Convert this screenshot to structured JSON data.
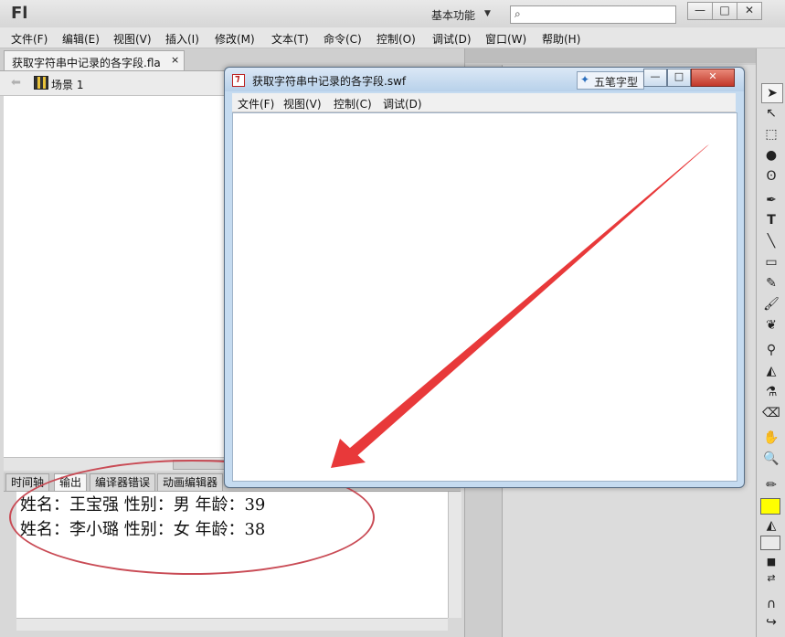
{
  "app": {
    "logo": "Fl",
    "workspace": "基本功能",
    "search_placeholder": ""
  },
  "window_controls": {
    "minimize": "—",
    "maximize": "□",
    "close": "✕"
  },
  "menubar": [
    "文件(F)",
    "编辑(E)",
    "视图(V)",
    "插入(I)",
    "修改(M)",
    "文本(T)",
    "命令(C)",
    "控制(O)",
    "调试(D)",
    "窗口(W)",
    "帮助(H)"
  ],
  "document": {
    "tab_label": "获取字符串中记录的各字段.fla",
    "tab_close": "×",
    "scene": "场景 1"
  },
  "panel_tabs": [
    "时间轴",
    "输出",
    "编译器错误",
    "动画编辑器"
  ],
  "output": {
    "line1": "姓名：王宝强 性别：男 年龄：39",
    "line2": "姓名：李小璐 性别：女 年龄：38"
  },
  "swf_window": {
    "title": "获取字符串中记录的各字段.swf",
    "ime_label": "五笔字型",
    "menu": [
      "文件(F)",
      "视图(V)",
      "控制(C)",
      "调试(D)"
    ]
  },
  "colors": {
    "annotation_red": "#c94b55",
    "arrow_red": "#e8393a",
    "fill_swatch": "#ffff00"
  }
}
